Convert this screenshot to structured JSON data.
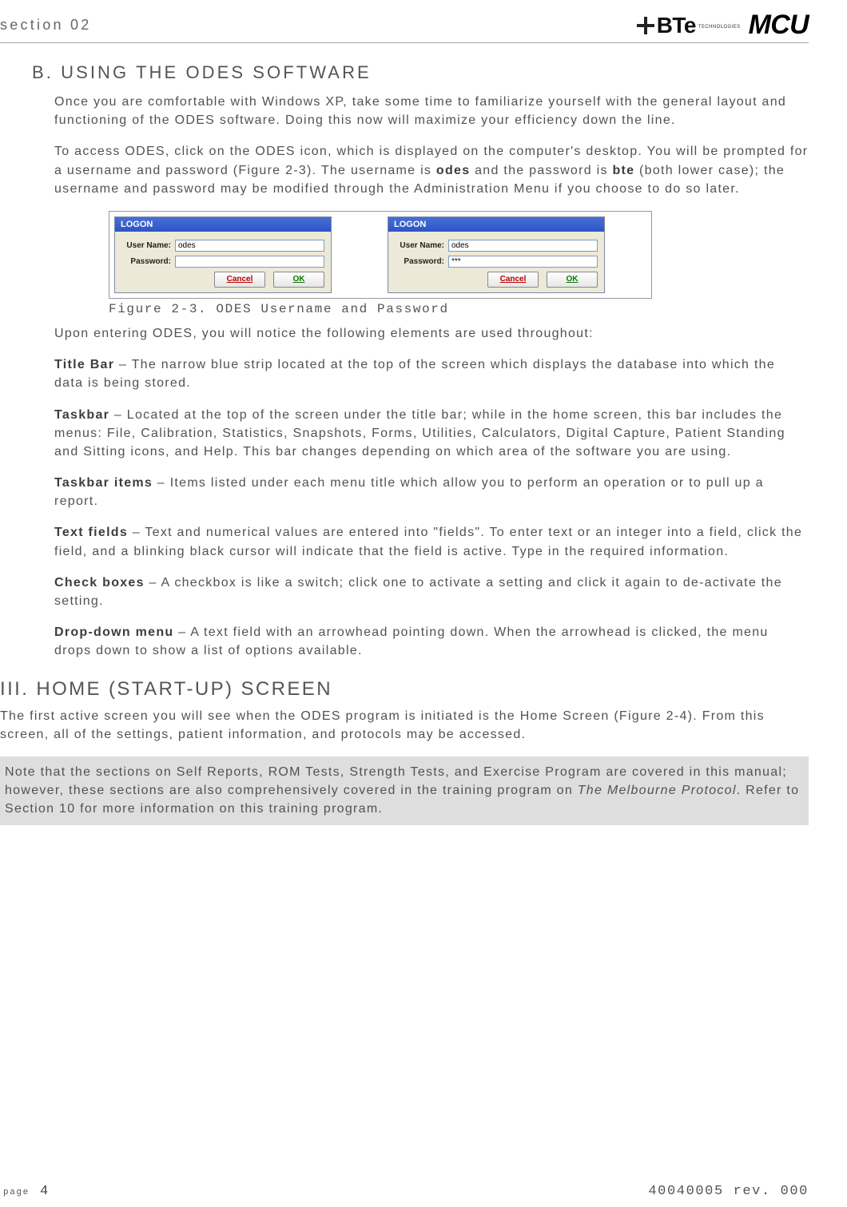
{
  "header": {
    "section_label": "section 02",
    "brand_bte": "BTe",
    "brand_bte_sub": "TECHNOLOGIES",
    "brand_mcu": "MCU"
  },
  "headings": {
    "b": "B. USING THE ODES SOFTWARE",
    "iii": "III. HOME (START-UP) SCREEN"
  },
  "para": {
    "p1": "Once you are comfortable with Windows XP, take some time to familiarize yourself with the general layout and functioning of the ODES software. Doing this now will maximize your efficiency down the line.",
    "p2a": "To access ODES, click on the ODES icon, which is displayed on the computer's desktop. You will be prompted for a username and password (Figure 2-3). The username is ",
    "p2_bold1": "odes",
    "p2b": " and the password is ",
    "p2_bold2": "bte",
    "p2c": " (both lower case); the username and password may be modified through the Administration Menu if you choose to do so later.",
    "p3": "Upon entering ODES, you will notice the following elements are used throughout:",
    "title_bar_lbl": "Title Bar",
    "title_bar_txt": " – The narrow blue strip located at the top of the screen which displays the database into which the data is being stored.",
    "taskbar_lbl": "Taskbar",
    "taskbar_txt": " – Located at the top of the screen under the title bar; while in the home screen, this bar includes the menus: File, Calibration, Statistics, Snapshots, Forms, Utilities, Calculators, Digital Capture, Patient Standing and Sitting icons, and Help. This bar changes depending on which area of the software you are using.",
    "taskbar_items_lbl": "Taskbar items",
    "taskbar_items_txt": " – Items listed under each menu title which allow you to perform an operation or to pull up a report.",
    "text_fields_lbl": "Text fields",
    "text_fields_txt": " – Text and numerical values are entered into \"fields\". To enter text or an integer into a field, click the field, and a blinking black cursor will indicate that the field is active. Type in the required information.",
    "check_boxes_lbl": "Check boxes",
    "check_boxes_txt": " – A checkbox is like a switch; click one to activate a setting and click it again to de-activate the setting.",
    "dropdown_lbl": "Drop-down menu",
    "dropdown_txt": " – A text field with an arrowhead pointing down. When the arrowhead is clicked, the menu drops down to show a list of options available.",
    "iii_p1": "The first active screen you will see when the ODES program is initiated is the Home Screen (Figure 2-4). From this screen, all of the settings, patient information, and protocols may be accessed.",
    "note_a": "Note that the sections on Self Reports, ROM Tests, Strength Tests, and Exercise Program are covered in this manual; however, these sections are also comprehensively covered in the training program on ",
    "note_ital": "The Melbourne Protocol",
    "note_b": ". Refer to Section 10 for more information on this training program."
  },
  "figure": {
    "caption": "Figure 2-3. ODES Username and Password",
    "logon": {
      "title": "LOGON",
      "user_label": "User Name:",
      "pass_label": "Password:",
      "user_value": "odes",
      "pass_value_masked": "***",
      "cancel": "Cancel",
      "ok": "OK"
    }
  },
  "footer": {
    "page_label": "page",
    "page_num": "4",
    "doc_id": "40040005 rev. 000"
  }
}
